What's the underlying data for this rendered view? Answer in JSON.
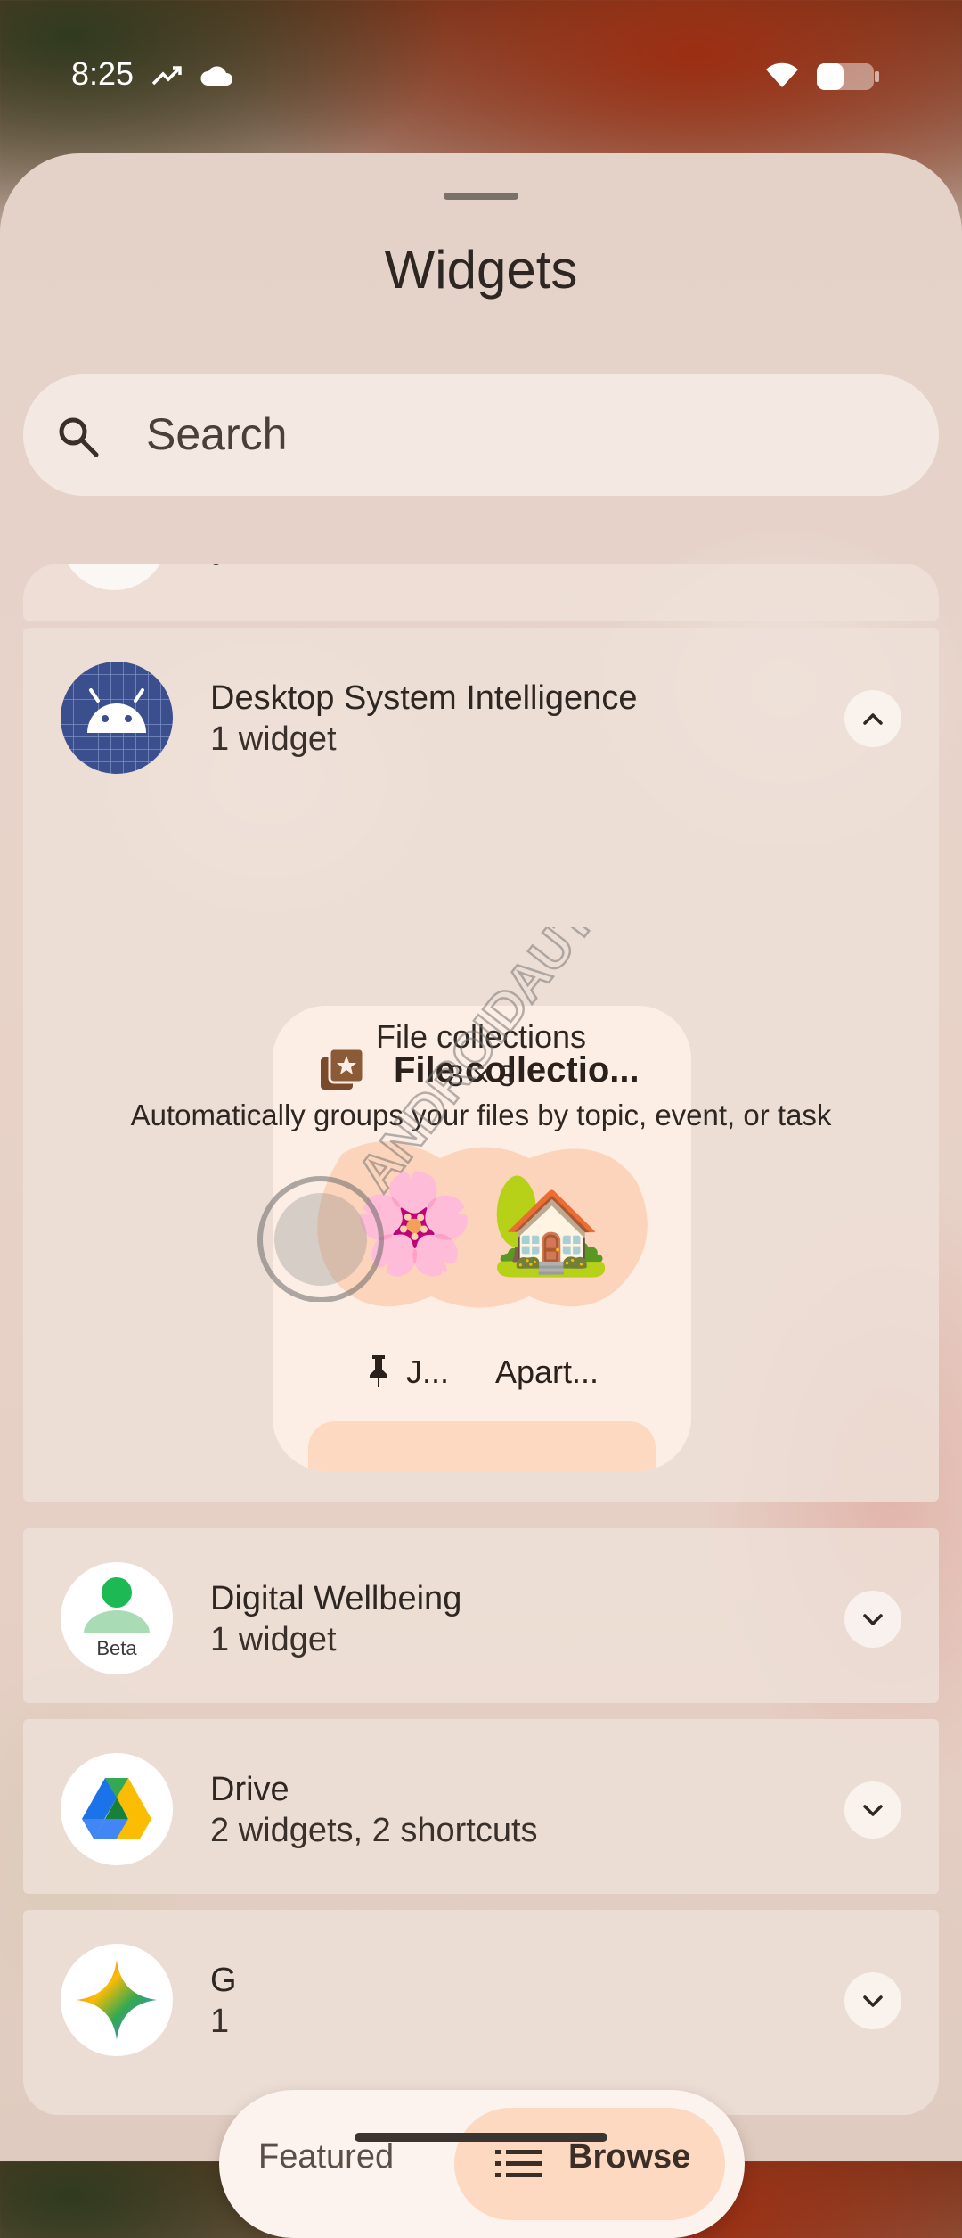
{
  "status_bar": {
    "time": "8:25",
    "icons": [
      "trending-icon",
      "cloud-icon",
      "wifi-icon",
      "battery-icon"
    ]
  },
  "sheet": {
    "title": "Widgets"
  },
  "search": {
    "placeholder": "Search"
  },
  "apps": [
    {
      "name": "Desktop System Intelligence",
      "subtitle": "1 widget",
      "expanded": true,
      "icon": "android-icon"
    },
    {
      "name": "Digital Wellbeing",
      "subtitle": "1 widget",
      "expanded": false,
      "icon": "digital-wellbeing-icon",
      "badge": "Beta"
    },
    {
      "name": "Drive",
      "subtitle": "2 widgets, 2 shortcuts",
      "expanded": false,
      "icon": "drive-icon"
    },
    {
      "name": "G",
      "subtitle": "1",
      "expanded": false,
      "icon": "gemini-icon"
    }
  ],
  "widget_preview": {
    "title": "File collectio...",
    "item1_label": "J...",
    "item2_label": "Apart...",
    "name": "File collections",
    "size": "3 × 3",
    "description": "Automatically groups your files by topic, event, or task"
  },
  "bottom_nav": {
    "featured_label": "Featured",
    "browse_label": "Browse",
    "selected": "Browse"
  },
  "watermark": {
    "text": "ANDROID AUTHORITY"
  },
  "colors": {
    "accent": "#fcd9c0",
    "preview_bg": "#fdeee5",
    "card_bg": "#eee0d8"
  }
}
